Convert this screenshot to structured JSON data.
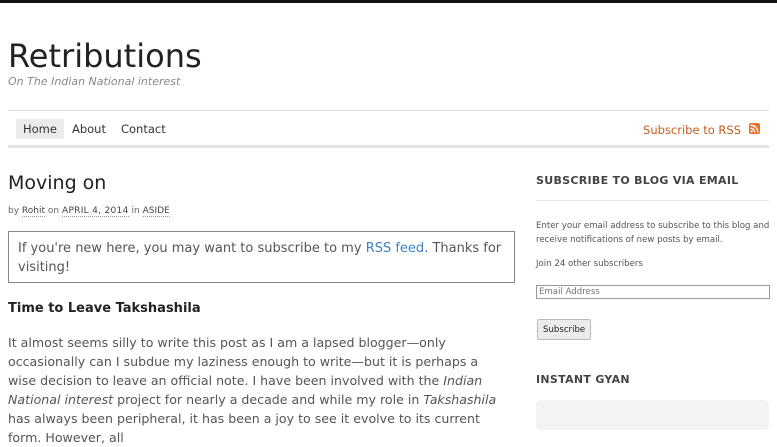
{
  "site": {
    "title": "Retributions",
    "tagline": "On The Indian National interest"
  },
  "nav": {
    "items": [
      {
        "label": "Home",
        "active": true
      },
      {
        "label": "About",
        "active": false
      },
      {
        "label": "Contact",
        "active": false
      }
    ],
    "rss_label": "Subscribe to RSS",
    "rss_icon": "rss-icon",
    "rss_color": "#e8722b"
  },
  "post": {
    "title": "Moving on",
    "meta": {
      "by": "by",
      "author": "Rohit",
      "on": "on",
      "date": "APRIL 4, 2014",
      "in": "in",
      "category": "ASIDE"
    },
    "notice": {
      "before": "If you're new here, you may want to subscribe to my ",
      "link": "RSS feed",
      "after": ". Thanks for visiting!"
    },
    "section_heading": "Time to Leave Takshashila",
    "body": {
      "p1": "It almost seems silly to write this post as I am a lapsed blogger—only occasionally can I subdue my laziness enough to write—but it is perhaps a wise decision to leave an official note. I have been involved with the ",
      "em1": "Indian National interest",
      "p2": " project for nearly a decade and while my role in ",
      "em2": "Takshashila",
      "p3": " has always been peripheral, it has been a joy to see it evolve to its current form. However, all"
    }
  },
  "sidebar": {
    "email_widget": {
      "heading": "SUBSCRIBE TO BLOG VIA EMAIL",
      "description": "Enter your email address to subscribe to this blog and receive notifications of new posts by email.",
      "subscribers": "Join 24 other subscribers",
      "input_placeholder": "Email Address",
      "button_label": "Subscribe"
    },
    "gyan_widget": {
      "heading": "INSTANT GYAN"
    }
  }
}
